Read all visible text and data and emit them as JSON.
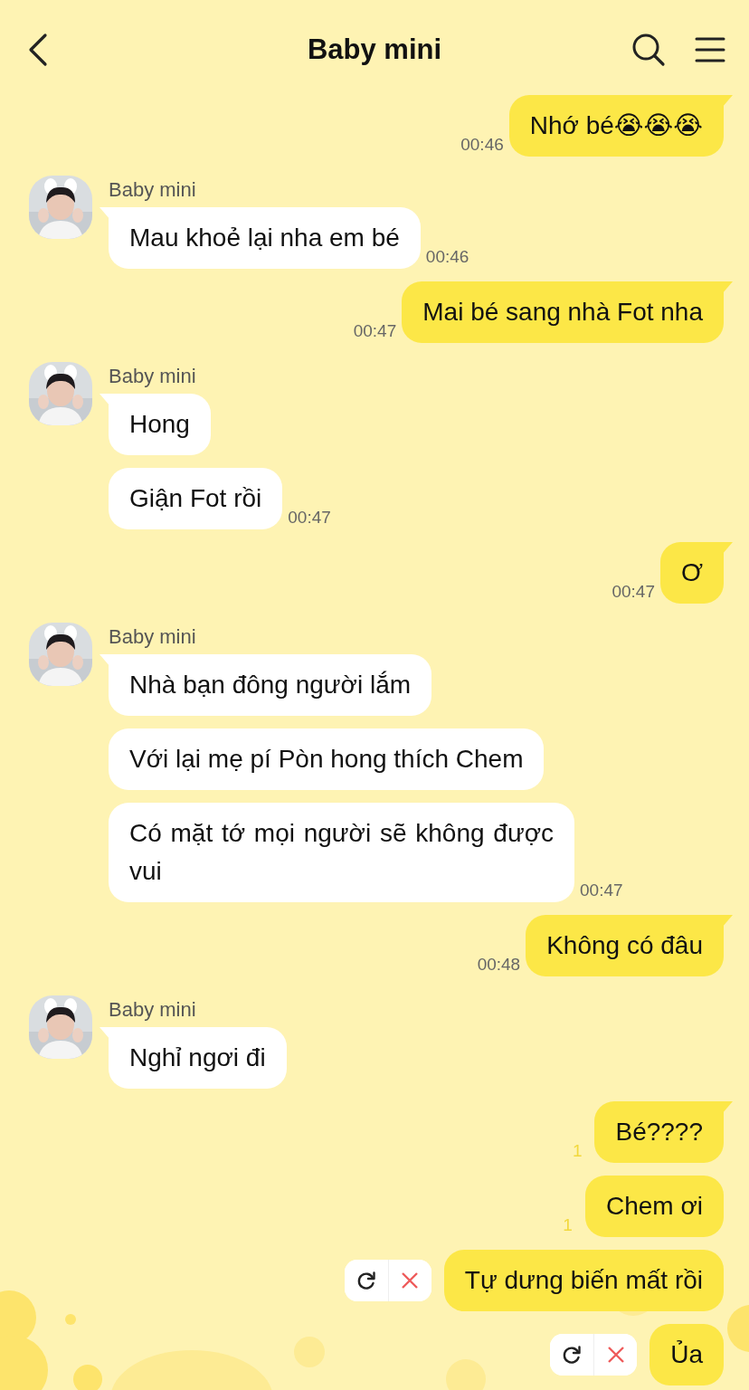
{
  "header": {
    "title": "Baby mini"
  },
  "messages": [
    {
      "kind": "sent",
      "text": "Nhớ bé😭😭😭",
      "time": "00:46",
      "failed": false
    },
    {
      "kind": "received",
      "sender": "Baby mini",
      "bubbles": [
        "Mau khoẻ lại nha em bé"
      ],
      "time": "00:46"
    },
    {
      "kind": "sent",
      "text": "Mai bé sang nhà Fot nha",
      "time": "00:47",
      "failed": false
    },
    {
      "kind": "received",
      "sender": "Baby mini",
      "bubbles": [
        "Hong",
        "Giận Fot rồi"
      ],
      "time": "00:47"
    },
    {
      "kind": "sent",
      "text": "Ơ",
      "time": "00:47",
      "failed": false
    },
    {
      "kind": "received",
      "sender": "Baby mini",
      "bubbles": [
        "Nhà bạn đông người lắm",
        "Với lại mẹ pí Pòn hong thích Chem",
        "Có mặt tớ mọi người sẽ không được vui"
      ],
      "time": "00:47"
    },
    {
      "kind": "sent",
      "text": "Không có đâu",
      "time": "00:48",
      "failed": false
    },
    {
      "kind": "received",
      "sender": "Baby mini",
      "bubbles": [
        "Nghỉ ngơi đi"
      ]
    },
    {
      "kind": "sent",
      "text": "Bé????",
      "unread": "1",
      "failed": false
    },
    {
      "kind": "sent",
      "text": "Chem ơi",
      "unread": "1",
      "failed": false
    },
    {
      "kind": "sent",
      "text": "Tự dưng biến mất rồi",
      "failed": true
    },
    {
      "kind": "sent",
      "text": "Ủa",
      "failed": true
    }
  ]
}
